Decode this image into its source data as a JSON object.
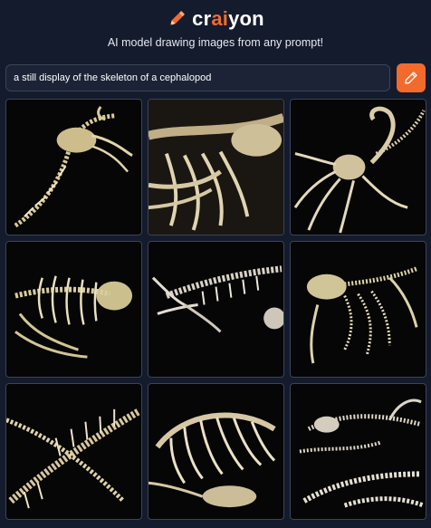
{
  "header": {
    "brand_prefix": "cr",
    "brand_accent": "ai",
    "brand_suffix": "yon",
    "tagline": "AI model drawing images from any prompt!"
  },
  "prompt": {
    "value": "a still display of the skeleton of a cephalopod",
    "button_icon": "pencil-icon"
  },
  "gallery": {
    "image_count": 9,
    "subject": "skeleton"
  },
  "colors": {
    "background": "#141b2d",
    "accent": "#f26b2c",
    "tile_background": "#060607"
  }
}
